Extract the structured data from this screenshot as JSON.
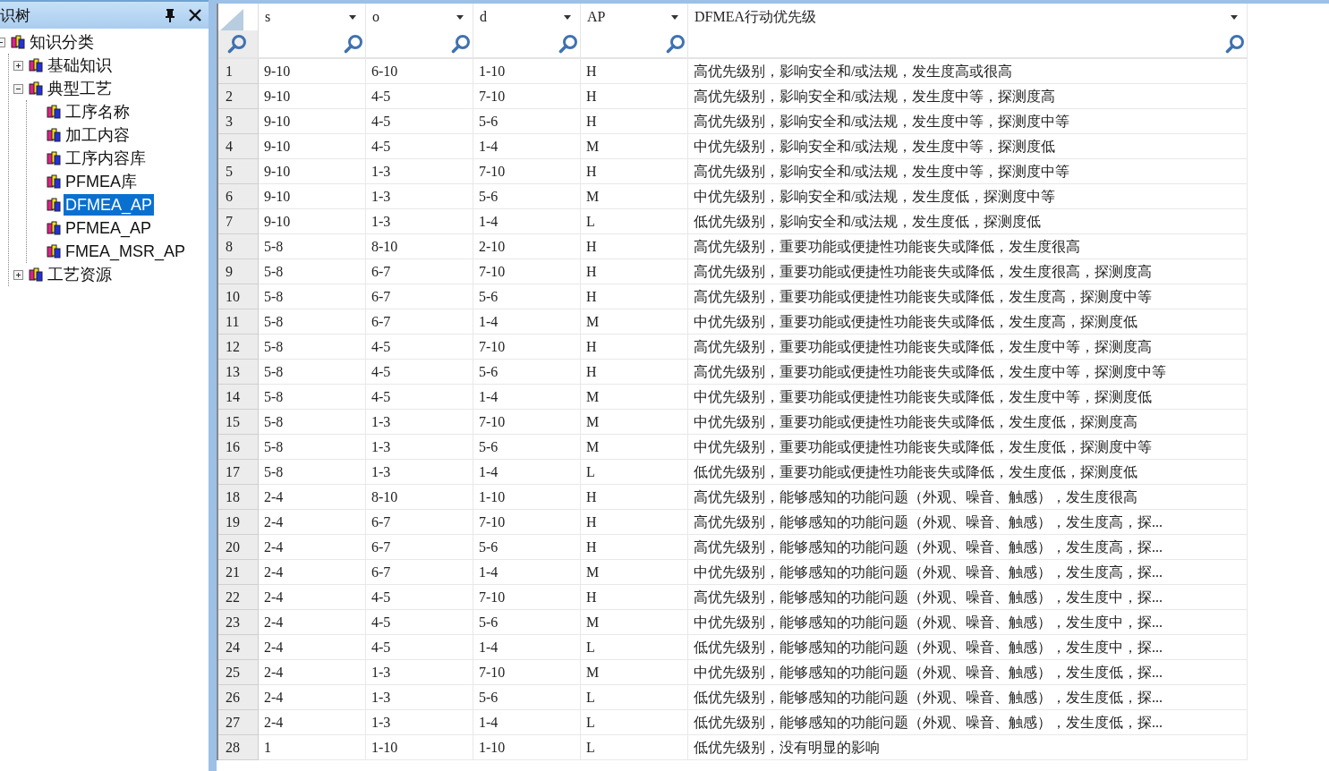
{
  "tree_panel": {
    "title": "识树",
    "tree": [
      {
        "label": "知识分类",
        "expanded": true,
        "selected": false,
        "children": [
          {
            "label": "基础知识",
            "expanded": false,
            "selected": false
          },
          {
            "label": "典型工艺",
            "expanded": true,
            "selected": false,
            "children": [
              {
                "label": "工序名称",
                "selected": false
              },
              {
                "label": "加工内容",
                "selected": false
              },
              {
                "label": "工序内容库",
                "selected": false
              },
              {
                "label": "PFMEA库",
                "selected": false
              },
              {
                "label": "DFMEA_AP",
                "selected": true
              },
              {
                "label": "PFMEA_AP",
                "selected": false
              },
              {
                "label": "FMEA_MSR_AP",
                "selected": false
              }
            ]
          },
          {
            "label": "工艺资源",
            "expanded": false,
            "selected": false
          }
        ]
      }
    ]
  },
  "table": {
    "columns": [
      "s",
      "o",
      "d",
      "AP",
      "DFMEA行动优先级"
    ],
    "rows": [
      {
        "number": "1",
        "cells": [
          "9-10",
          "6-10",
          "1-10",
          "H",
          "高优先级别，影响安全和/或法规，发生度高或很高"
        ]
      },
      {
        "number": "2",
        "cells": [
          "9-10",
          "4-5",
          "7-10",
          "H",
          "高优先级别，影响安全和/或法规，发生度中等，探测度高"
        ]
      },
      {
        "number": "3",
        "cells": [
          "9-10",
          "4-5",
          "5-6",
          "H",
          "高优先级别，影响安全和/或法规，发生度中等，探测度中等"
        ]
      },
      {
        "number": "4",
        "cells": [
          "9-10",
          "4-5",
          "1-4",
          "M",
          "中优先级别，影响安全和/或法规，发生度中等，探测度低"
        ]
      },
      {
        "number": "5",
        "cells": [
          "9-10",
          "1-3",
          "7-10",
          "H",
          "高优先级别，影响安全和/或法规，发生度中等，探测度中等"
        ]
      },
      {
        "number": "6",
        "cells": [
          "9-10",
          "1-3",
          "5-6",
          "M",
          "中优先级别，影响安全和/或法规，发生度低，探测度中等"
        ]
      },
      {
        "number": "7",
        "cells": [
          "9-10",
          "1-3",
          "1-4",
          "L",
          "低优先级别，影响安全和/或法规，发生度低，探测度低"
        ]
      },
      {
        "number": "8",
        "cells": [
          "5-8",
          "8-10",
          "2-10",
          "H",
          "高优先级别，重要功能或便捷性功能丧失或降低，发生度很高"
        ]
      },
      {
        "number": "9",
        "cells": [
          "5-8",
          "6-7",
          "7-10",
          "H",
          "高优先级别，重要功能或便捷性功能丧失或降低，发生度很高，探测度高"
        ]
      },
      {
        "number": "10",
        "cells": [
          "5-8",
          "6-7",
          "5-6",
          "H",
          "高优先级别，重要功能或便捷性功能丧失或降低，发生度高，探测度中等"
        ]
      },
      {
        "number": "11",
        "cells": [
          "5-8",
          "6-7",
          "1-4",
          "M",
          "中优先级别，重要功能或便捷性功能丧失或降低，发生度高，探测度低"
        ]
      },
      {
        "number": "12",
        "cells": [
          "5-8",
          "4-5",
          "7-10",
          "H",
          "高优先级别，重要功能或便捷性功能丧失或降低，发生度中等，探测度高"
        ]
      },
      {
        "number": "13",
        "cells": [
          "5-8",
          "4-5",
          "5-6",
          "H",
          "高优先级别，重要功能或便捷性功能丧失或降低，发生度中等，探测度中等"
        ]
      },
      {
        "number": "14",
        "cells": [
          "5-8",
          "4-5",
          "1-4",
          "M",
          "中优先级别，重要功能或便捷性功能丧失或降低，发生度中等，探测度低"
        ]
      },
      {
        "number": "15",
        "cells": [
          "5-8",
          "1-3",
          "7-10",
          "M",
          "中优先级别，重要功能或便捷性功能丧失或降低，发生度低，探测度高"
        ]
      },
      {
        "number": "16",
        "cells": [
          "5-8",
          "1-3",
          "5-6",
          "M",
          "中优先级别，重要功能或便捷性功能丧失或降低，发生度低，探测度中等"
        ]
      },
      {
        "number": "17",
        "cells": [
          "5-8",
          "1-3",
          "1-4",
          "L",
          "低优先级别，重要功能或便捷性功能丧失或降低，发生度低，探测度低"
        ]
      },
      {
        "number": "18",
        "cells": [
          "2-4",
          "8-10",
          "1-10",
          "H",
          "高优先级别，能够感知的功能问题（外观、噪音、触感），发生度很高"
        ]
      },
      {
        "number": "19",
        "cells": [
          "2-4",
          "6-7",
          "7-10",
          "H",
          "高优先级别，能够感知的功能问题（外观、噪音、触感），发生度高，探..."
        ]
      },
      {
        "number": "20",
        "cells": [
          "2-4",
          "6-7",
          "5-6",
          "H",
          "高优先级别，能够感知的功能问题（外观、噪音、触感），发生度高，探..."
        ]
      },
      {
        "number": "21",
        "cells": [
          "2-4",
          "6-7",
          "1-4",
          "M",
          "中优先级别，能够感知的功能问题（外观、噪音、触感），发生度高，探..."
        ]
      },
      {
        "number": "22",
        "cells": [
          "2-4",
          "4-5",
          "7-10",
          "H",
          "高优先级别，能够感知的功能问题（外观、噪音、触感），发生度中，探..."
        ]
      },
      {
        "number": "23",
        "cells": [
          "2-4",
          "4-5",
          "5-6",
          "M",
          "中优先级别，能够感知的功能问题（外观、噪音、触感），发生度中，探..."
        ]
      },
      {
        "number": "24",
        "cells": [
          "2-4",
          "4-5",
          "1-4",
          "L",
          "低优先级别，能够感知的功能问题（外观、噪音、触感），发生度中，探..."
        ]
      },
      {
        "number": "25",
        "cells": [
          "2-4",
          "1-3",
          "7-10",
          "M",
          "中优先级别，能够感知的功能问题（外观、噪音、触感），发生度低，探..."
        ]
      },
      {
        "number": "26",
        "cells": [
          "2-4",
          "1-3",
          "5-6",
          "L",
          "低优先级别，能够感知的功能问题（外观、噪音、触感），发生度低，探..."
        ]
      },
      {
        "number": "27",
        "cells": [
          "2-4",
          "1-3",
          "1-4",
          "L",
          "低优先级别，能够感知的功能问题（外观、噪音、触感），发生度低，探..."
        ]
      },
      {
        "number": "28",
        "cells": [
          "1",
          "1-10",
          "1-10",
          "L",
          "低优先级别，没有明显的影响"
        ]
      }
    ]
  }
}
